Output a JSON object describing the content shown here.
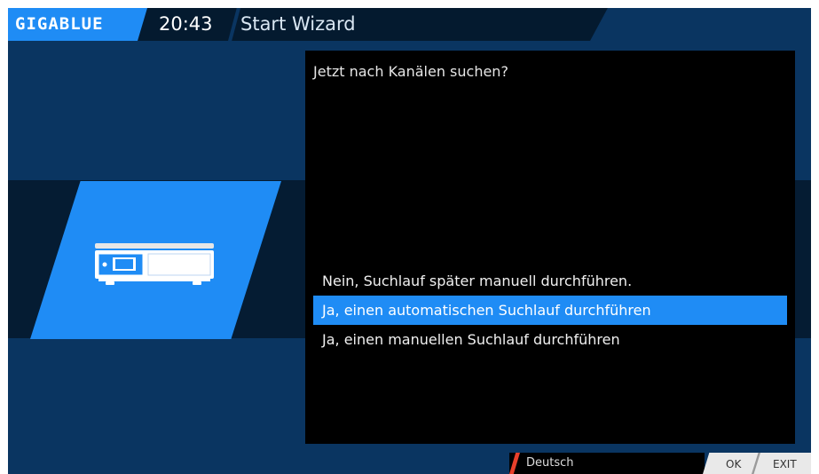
{
  "header": {
    "logo_text": "GIGABLUE",
    "time": "20:43",
    "title": "Start Wizard"
  },
  "dialog": {
    "question": "Jetzt nach Kanälen suchen?",
    "options": [
      {
        "label": "Nein, Suchlauf später manuell durchführen.",
        "selected": false
      },
      {
        "label": "Ja, einen automatischen Suchlauf durchführen",
        "selected": true
      },
      {
        "label": "Ja, einen manuellen Suchlauf durchführen",
        "selected": false
      }
    ]
  },
  "footer": {
    "language": "Deutsch",
    "ok_label": "OK",
    "exit_label": "EXIT"
  },
  "icons": {
    "device": "receiver-box-icon"
  },
  "colors": {
    "accent": "#1f8cf5",
    "background": "#0a3561",
    "dark_band": "#051c33",
    "lang_marker": "#e8402b"
  }
}
